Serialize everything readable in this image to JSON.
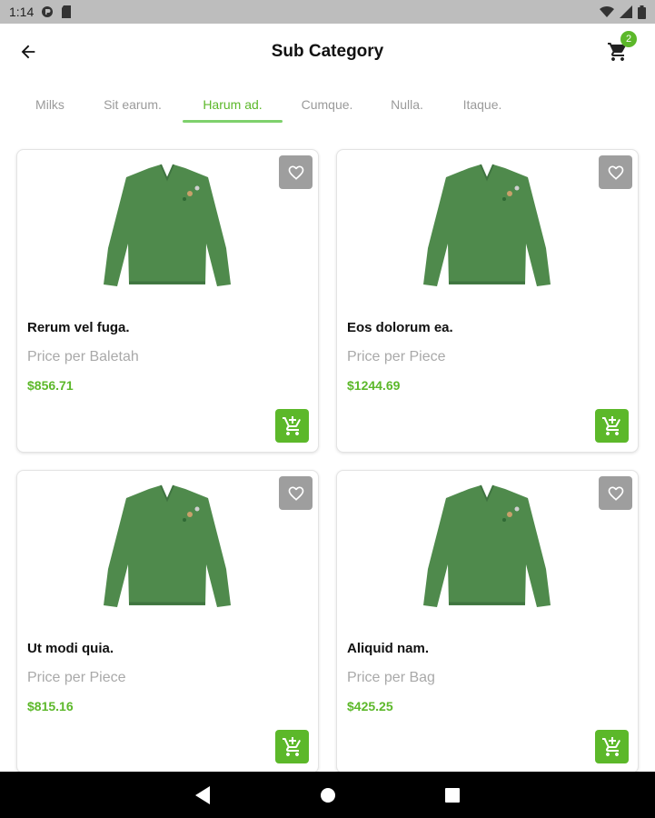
{
  "status_bar": {
    "time": "1:14"
  },
  "header": {
    "title": "Sub Category",
    "cart_count": "2"
  },
  "tabs": [
    {
      "label": "Milks"
    },
    {
      "label": "Sit earum."
    },
    {
      "label": "Harum ad."
    },
    {
      "label": "Cumque."
    },
    {
      "label": "Nulla."
    },
    {
      "label": "Itaque."
    }
  ],
  "active_tab_index": 2,
  "products": [
    {
      "name": "Rerum vel fuga.",
      "unit": "Price per Baletah",
      "price": "$856.71"
    },
    {
      "name": "Eos dolorum ea.",
      "unit": "Price per Piece",
      "price": "$1244.69"
    },
    {
      "name": "Ut modi quia.",
      "unit": "Price per Piece",
      "price": "$815.16"
    },
    {
      "name": "Aliquid nam.",
      "unit": "Price per Bag",
      "price": "$425.25"
    }
  ],
  "colors": {
    "accent": "#5cb82a",
    "favorite_bg": "#9e9e9e",
    "product_color": "#4f8a4c"
  },
  "icons": {
    "back": "arrow-left-icon",
    "cart": "cart-icon",
    "favorite": "heart-outline-icon",
    "add_to_cart": "add-to-cart-icon"
  }
}
